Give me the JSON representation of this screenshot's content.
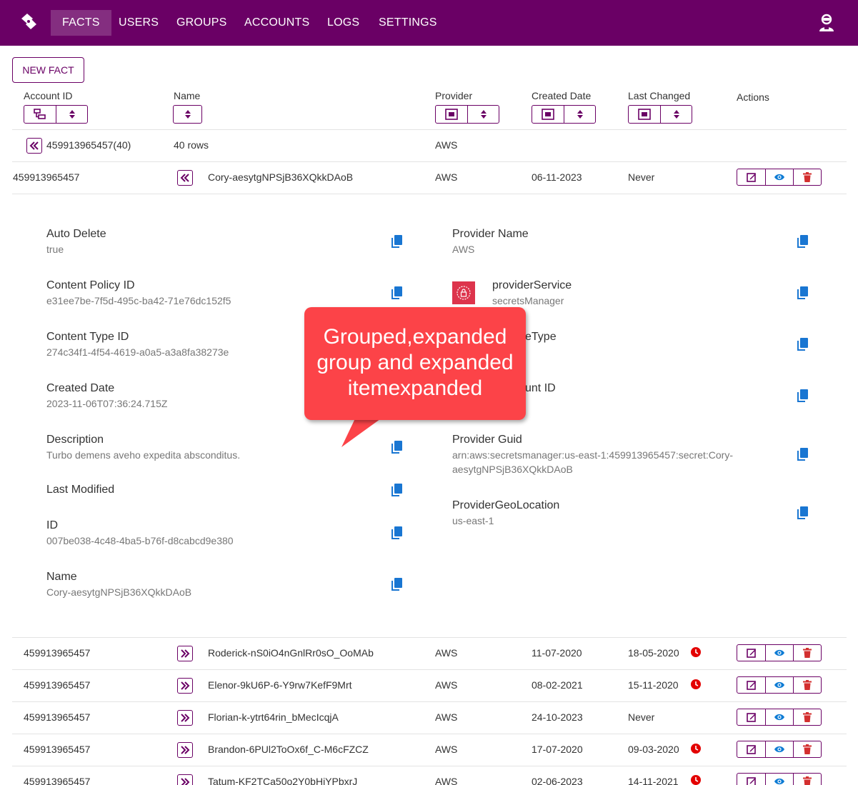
{
  "nav": {
    "items": [
      "FACTS",
      "USERS",
      "GROUPS",
      "ACCOUNTS",
      "LOGS",
      "SETTINGS"
    ],
    "active": "FACTS"
  },
  "toolbar": {
    "new_fact_label": "NEW FACT"
  },
  "table": {
    "columns": {
      "account_id": "Account ID",
      "name": "Name",
      "provider": "Provider",
      "created_date": "Created Date",
      "last_changed": "Last Changed",
      "actions": "Actions"
    },
    "group_row": {
      "label": "459913965457(40)",
      "rows_label": "40 rows",
      "provider": "AWS"
    },
    "expanded_row": {
      "account_id": "459913965457",
      "name": "Cory-aesytgNPSjB36XQkkDAoB",
      "provider": "AWS",
      "created": "06-11-2023",
      "last_changed": "Never"
    },
    "rows": [
      {
        "account_id": "459913965457",
        "name": "Roderick-nS0iO4nGnlRr0sO_OoMAb",
        "provider": "AWS",
        "created": "11-07-2020",
        "last_changed": "18-05-2020",
        "overdue": true
      },
      {
        "account_id": "459913965457",
        "name": "Elenor-9kU6P-6-Y9rw7KefF9Mrt",
        "provider": "AWS",
        "created": "08-02-2021",
        "last_changed": "15-11-2020",
        "overdue": true
      },
      {
        "account_id": "459913965457",
        "name": "Florian-k-ytrt64rin_bMecIcqjA",
        "provider": "AWS",
        "created": "24-10-2023",
        "last_changed": "Never",
        "overdue": false
      },
      {
        "account_id": "459913965457",
        "name": "Brandon-6PUl2ToOx6f_C-M6cFZCZ",
        "provider": "AWS",
        "created": "17-07-2020",
        "last_changed": "09-03-2020",
        "overdue": true
      },
      {
        "account_id": "459913965457",
        "name": "Tatum-KF2TCa50o2Y0bHiYPbxrJ",
        "provider": "AWS",
        "created": "02-06-2023",
        "last_changed": "14-11-2021",
        "overdue": true
      }
    ]
  },
  "details": {
    "left": [
      {
        "label": "Auto Delete",
        "value": "true"
      },
      {
        "label": "Content Policy ID",
        "value": "e31ee7be-7f5d-495c-ba42-71e76dc152f5"
      },
      {
        "label": "Content Type ID",
        "value": "274c34f1-4f54-4619-a0a5-a3a8fa38273e"
      },
      {
        "label": "Created Date",
        "value": "2023-11-06T07:36:24.715Z"
      },
      {
        "label": "Description",
        "value": "Turbo demens aveho expedita absconditus."
      },
      {
        "label": "Last Modified",
        "value": ""
      },
      {
        "label": "ID",
        "value": "007be038-4c48-4ba5-b76f-d8cabcd9e380"
      },
      {
        "label": "Name",
        "value": "Cory-aesytgNPSjB36XQkkDAoB"
      }
    ],
    "right": [
      {
        "label": "Provider Name",
        "value": "AWS"
      },
      {
        "label": "providerService",
        "value": "secretsManager"
      },
      {
        "label": "eType",
        "value": ""
      },
      {
        "label": "unt ID",
        "value": ""
      },
      {
        "label": "Provider Guid",
        "value_line1": "arn:aws:secretsmanager:us-east-1:459913965457:secret:Cory-",
        "value_line2": "aesytgNPSjB36XQkkDAoB"
      },
      {
        "label": "ProviderGeoLocation",
        "value": "us-east-1"
      }
    ]
  },
  "callout": {
    "line1": "Grouped,expanded",
    "line2": "group and expanded",
    "line3": "itemexpanded"
  },
  "colors": {
    "brand": "#6a0065",
    "edit": "#6a0065",
    "view": "#0d7bd4",
    "delete": "#d32f2f",
    "copy": "#1976d2",
    "callout": "#fc4348",
    "overdue": "#e30000"
  },
  "icons": {
    "logo": "app-logo-icon",
    "user": "user-account-icon",
    "sort_group": "group-by-icon",
    "sort": "sort-icon",
    "collapse": "chevrons-left-icon",
    "expand": "chevrons-right-icon",
    "edit": "edit-icon",
    "view": "eye-icon",
    "delete": "trash-icon",
    "copy": "copy-icon",
    "clock": "clock-icon",
    "service": "aws-secrets-manager-icon"
  }
}
